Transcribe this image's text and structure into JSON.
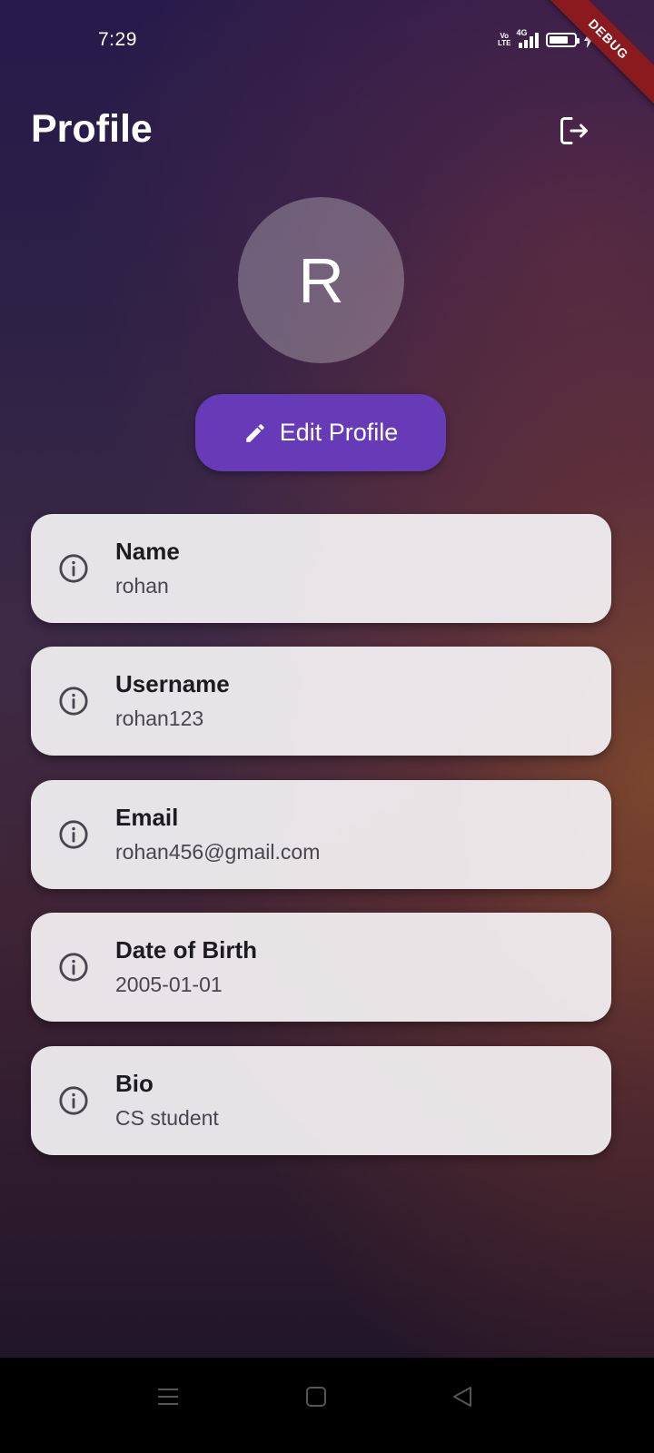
{
  "status_bar": {
    "time": "7:29",
    "volte_top": "Vo",
    "volte_bottom": "LTE",
    "network": "4G",
    "battery_level": 0.8
  },
  "debug_banner": "DEBUG",
  "header": {
    "title": "Profile",
    "logout_icon": "logout-icon"
  },
  "avatar": {
    "initial": "R"
  },
  "edit_button": {
    "label": "Edit Profile",
    "icon": "pencil-icon",
    "color": "#673ab7"
  },
  "fields": [
    {
      "label": "Name",
      "value": "rohan"
    },
    {
      "label": "Username",
      "value": "rohan123"
    },
    {
      "label": "Email",
      "value": "rohan456@gmail.com"
    },
    {
      "label": "Date of Birth",
      "value": "2005-01-01"
    },
    {
      "label": "Bio",
      "value": "CS student"
    }
  ],
  "nav": {
    "menu_icon": "menu-icon",
    "home_icon": "home-square-icon",
    "back_icon": "back-triangle-icon"
  }
}
